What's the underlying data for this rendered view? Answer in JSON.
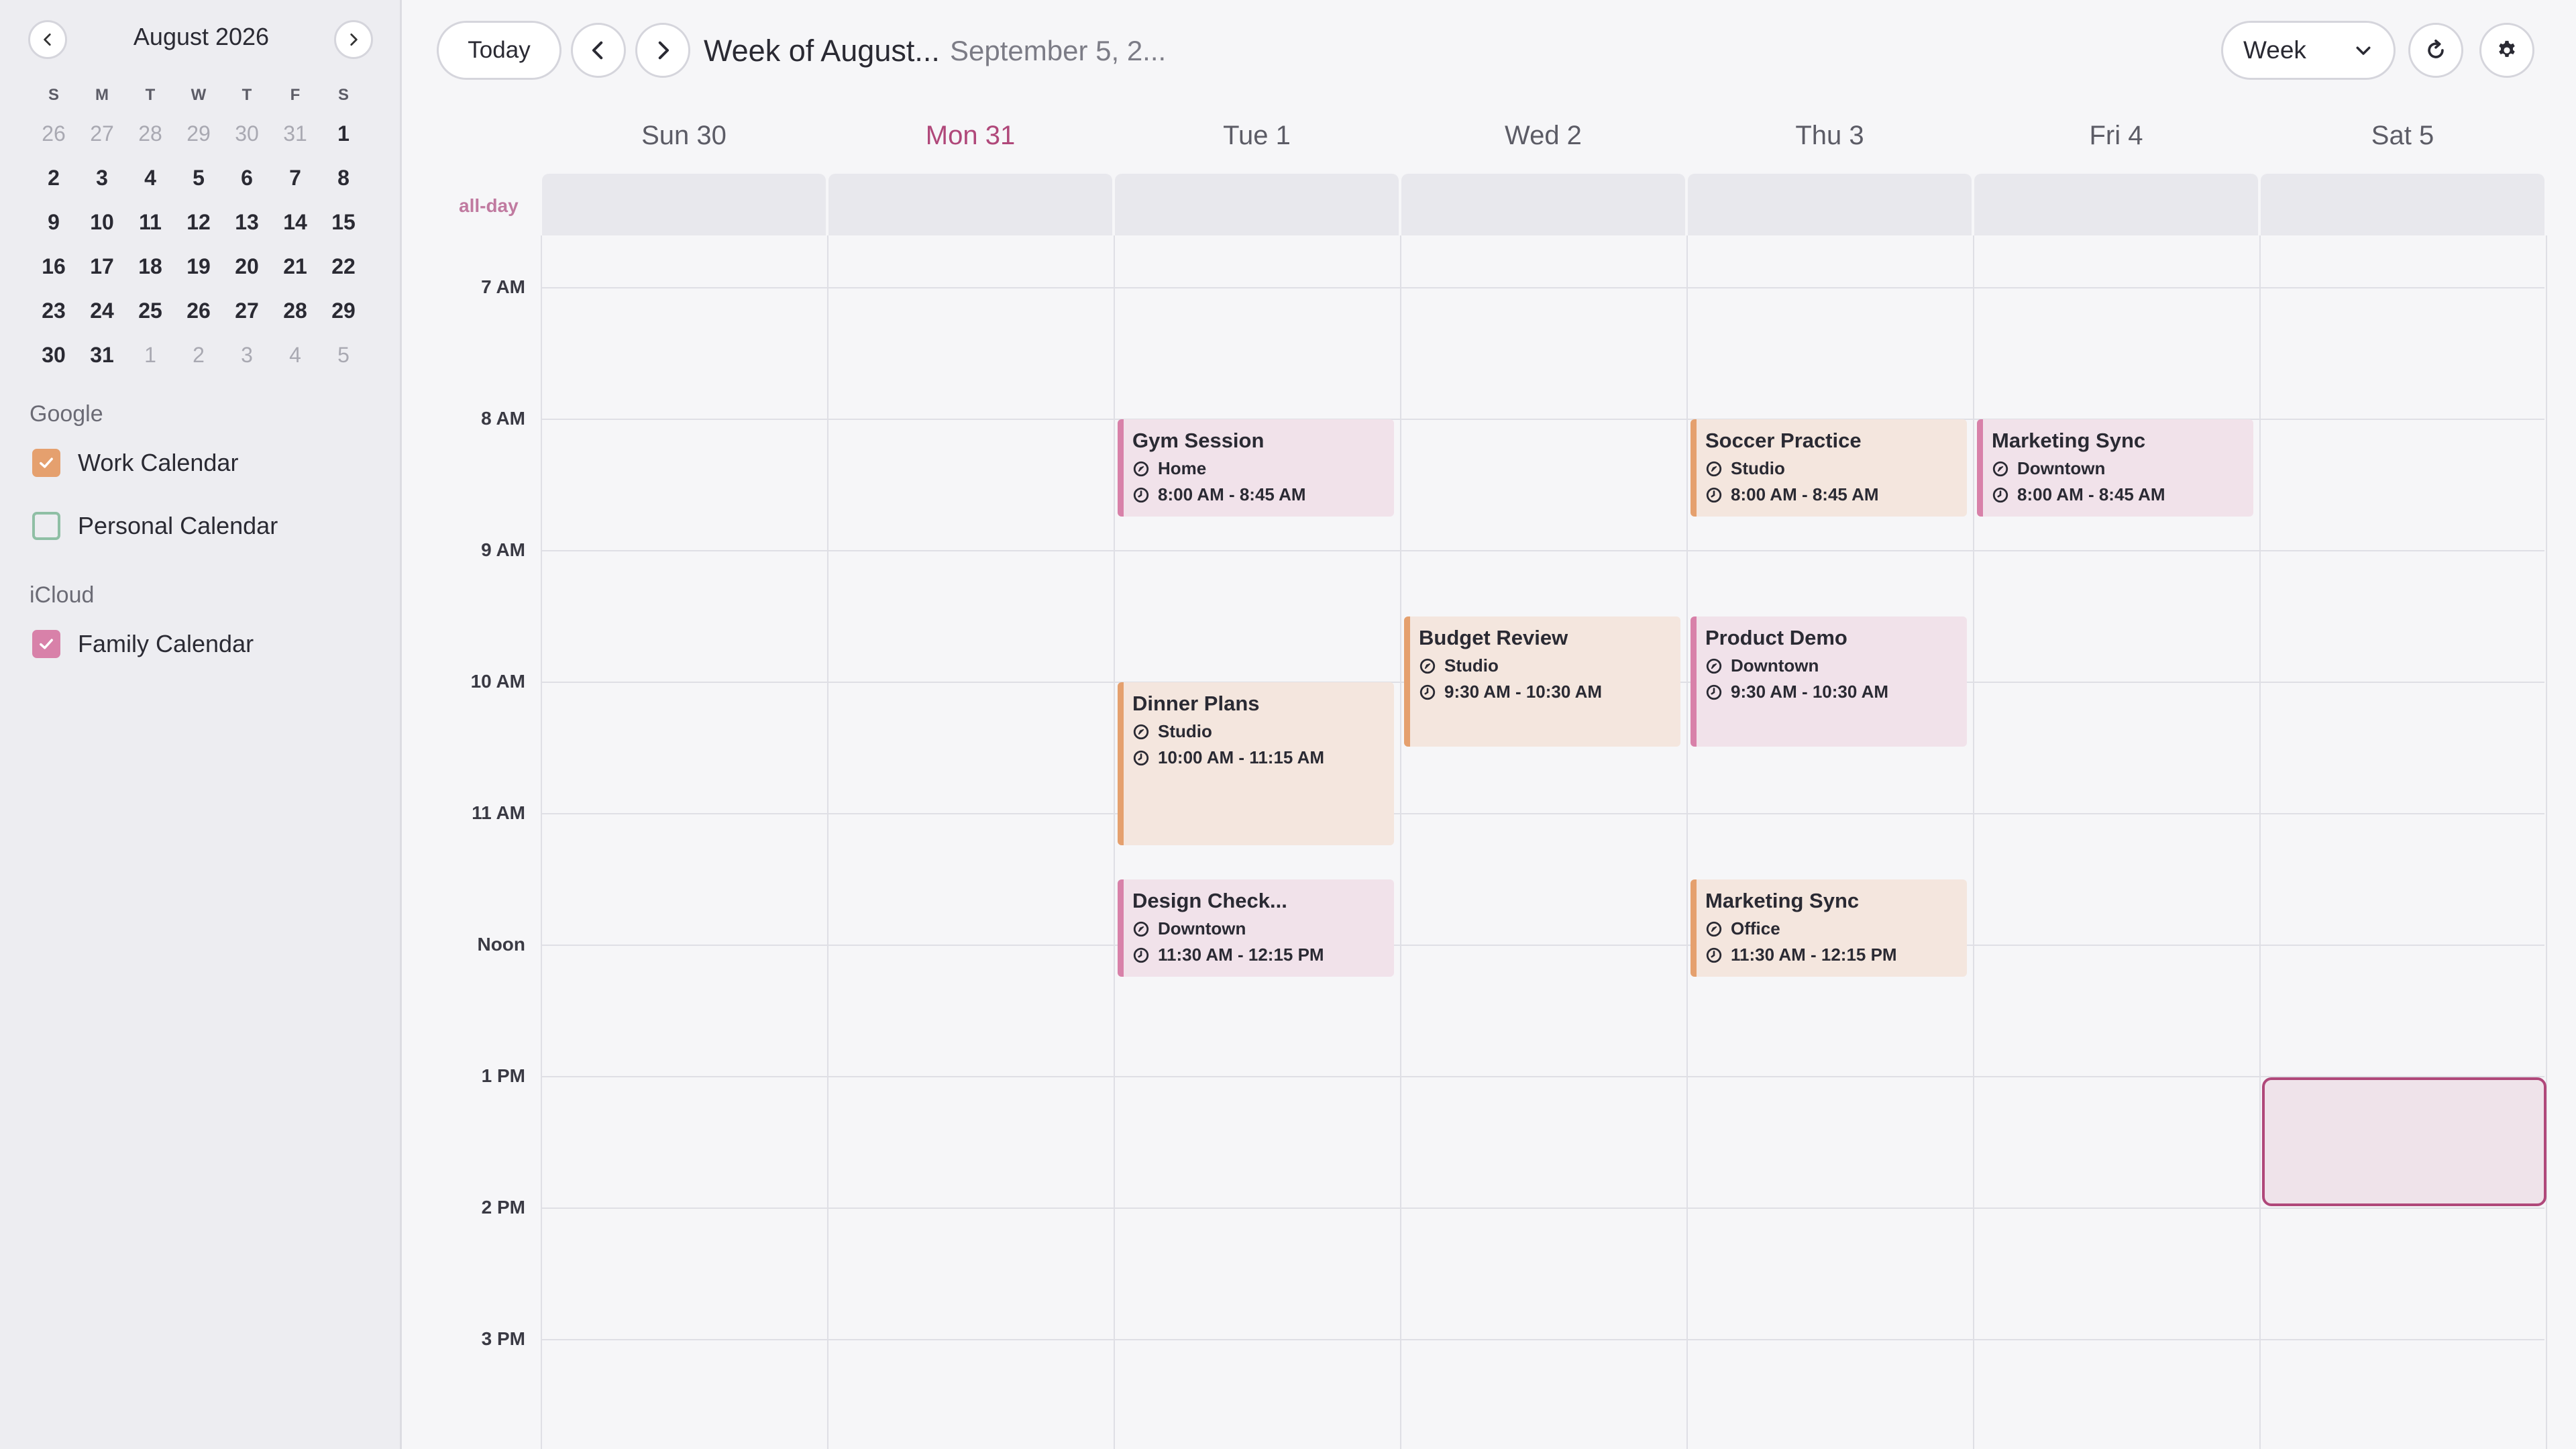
{
  "mini_calendar": {
    "month_label": "August 2026",
    "weekdays": [
      "S",
      "M",
      "T",
      "W",
      "T",
      "F",
      "S"
    ],
    "days": [
      {
        "d": "26",
        "muted": true
      },
      {
        "d": "27",
        "muted": true
      },
      {
        "d": "28",
        "muted": true
      },
      {
        "d": "29",
        "muted": true
      },
      {
        "d": "30",
        "muted": true
      },
      {
        "d": "31",
        "muted": true
      },
      {
        "d": "1",
        "muted": false
      },
      {
        "d": "2",
        "muted": false
      },
      {
        "d": "3",
        "muted": false
      },
      {
        "d": "4",
        "muted": false
      },
      {
        "d": "5",
        "muted": false
      },
      {
        "d": "6",
        "muted": false
      },
      {
        "d": "7",
        "muted": false
      },
      {
        "d": "8",
        "muted": false
      },
      {
        "d": "9",
        "muted": false
      },
      {
        "d": "10",
        "muted": false
      },
      {
        "d": "11",
        "muted": false
      },
      {
        "d": "12",
        "muted": false
      },
      {
        "d": "13",
        "muted": false
      },
      {
        "d": "14",
        "muted": false
      },
      {
        "d": "15",
        "muted": false
      },
      {
        "d": "16",
        "muted": false
      },
      {
        "d": "17",
        "muted": false
      },
      {
        "d": "18",
        "muted": false
      },
      {
        "d": "19",
        "muted": false
      },
      {
        "d": "20",
        "muted": false
      },
      {
        "d": "21",
        "muted": false
      },
      {
        "d": "22",
        "muted": false
      },
      {
        "d": "23",
        "muted": false
      },
      {
        "d": "24",
        "muted": false
      },
      {
        "d": "25",
        "muted": false
      },
      {
        "d": "26",
        "muted": false
      },
      {
        "d": "27",
        "muted": false
      },
      {
        "d": "28",
        "muted": false
      },
      {
        "d": "29",
        "muted": false
      },
      {
        "d": "30",
        "muted": false
      },
      {
        "d": "31",
        "muted": false
      },
      {
        "d": "1",
        "muted": true
      },
      {
        "d": "2",
        "muted": true
      },
      {
        "d": "3",
        "muted": true
      },
      {
        "d": "4",
        "muted": true
      },
      {
        "d": "5",
        "muted": true
      }
    ]
  },
  "calendar_groups": [
    {
      "label": "Google",
      "calendars": [
        {
          "name": "Work Calendar",
          "checked": true,
          "color": "#e5a06e"
        },
        {
          "name": "Personal Calendar",
          "checked": false,
          "color": "#8fbfa5"
        }
      ]
    },
    {
      "label": "iCloud",
      "calendars": [
        {
          "name": "Family Calendar",
          "checked": true,
          "color": "#d881a9"
        }
      ]
    }
  ],
  "header": {
    "today_label": "Today",
    "title": "Week of August...",
    "subtitle": "September 5, 2...",
    "view_label": "Week"
  },
  "week": {
    "allday_label": "all-day",
    "days": [
      {
        "label": "Sun 30",
        "today": false
      },
      {
        "label": "Mon 31",
        "today": true
      },
      {
        "label": "Tue 1",
        "today": false
      },
      {
        "label": "Wed 2",
        "today": false
      },
      {
        "label": "Thu 3",
        "today": false
      },
      {
        "label": "Fri 4",
        "today": false
      },
      {
        "label": "Sat 5",
        "today": false
      }
    ],
    "hours": [
      "7 AM",
      "8 AM",
      "9 AM",
      "10 AM",
      "11 AM",
      "Noon",
      "1 PM",
      "2 PM",
      "3 PM"
    ],
    "first_hour": 7,
    "selection": {
      "day": 6,
      "start": 13,
      "end": 14
    }
  },
  "events": [
    {
      "title": "Gym Session",
      "location": "Home",
      "time": "8:00 AM - 8:45 AM",
      "day": 2,
      "start": 8.0,
      "end": 8.75,
      "color": "pink"
    },
    {
      "title": "Dinner Plans",
      "location": "Studio",
      "time": "10:00 AM - 11:15 AM",
      "day": 2,
      "start": 10.0,
      "end": 11.25,
      "color": "orange"
    },
    {
      "title": "Design Check...",
      "location": "Downtown",
      "time": "11:30 AM - 12:15 PM",
      "day": 2,
      "start": 11.5,
      "end": 12.25,
      "color": "pink"
    },
    {
      "title": "Budget Review",
      "location": "Studio",
      "time": "9:30 AM - 10:30 AM",
      "day": 3,
      "start": 9.5,
      "end": 10.5,
      "color": "orange"
    },
    {
      "title": "Soccer Practice",
      "location": "Studio",
      "time": "8:00 AM - 8:45 AM",
      "day": 4,
      "start": 8.0,
      "end": 8.75,
      "color": "orange"
    },
    {
      "title": "Product Demo",
      "location": "Downtown",
      "time": "9:30 AM - 10:30 AM",
      "day": 4,
      "start": 9.5,
      "end": 10.5,
      "color": "pink"
    },
    {
      "title": "Marketing Sync",
      "location": "Office",
      "time": "11:30 AM - 12:15 PM",
      "day": 4,
      "start": 11.5,
      "end": 12.25,
      "color": "orange"
    },
    {
      "title": "Marketing Sync",
      "location": "Downtown",
      "time": "8:00 AM - 8:45 AM",
      "day": 5,
      "start": 8.0,
      "end": 8.75,
      "color": "pink"
    }
  ]
}
